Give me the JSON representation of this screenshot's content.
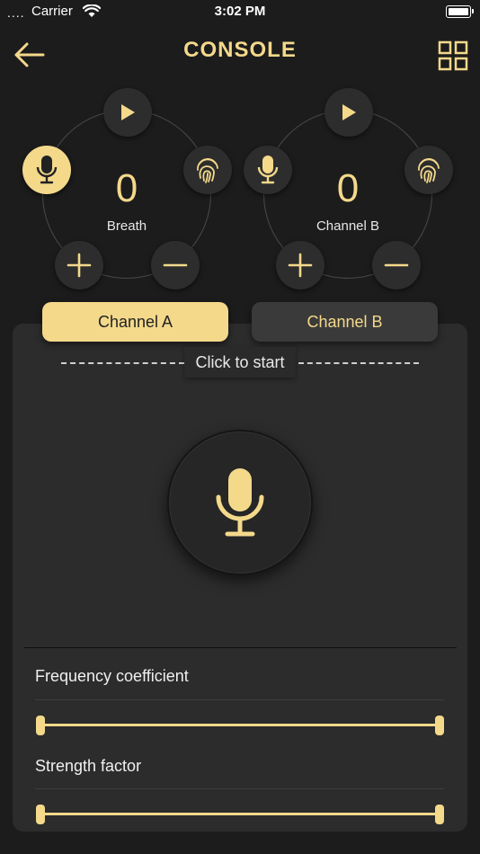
{
  "status_bar": {
    "signal": "....",
    "carrier": "Carrier",
    "time": "3:02 PM"
  },
  "nav": {
    "title": "CONSOLE",
    "back_icon": "arrow-left-icon",
    "menu_icon": "grid-icon"
  },
  "dials": [
    {
      "value": "0",
      "label": "Breath",
      "active_button": "mic"
    },
    {
      "value": "0",
      "label": "Channel B",
      "active_button": "none"
    }
  ],
  "tabs": [
    {
      "label": "Channel A",
      "selected": true
    },
    {
      "label": "Channel B",
      "selected": false
    }
  ],
  "panel": {
    "start_text": "Click to start",
    "params": [
      {
        "label": "Frequency coefficient",
        "range": [
          0,
          1
        ]
      },
      {
        "label": "Strength factor",
        "range": [
          0,
          1
        ]
      }
    ]
  },
  "colors": {
    "accent": "#f4d98b",
    "background": "#1c1c1c",
    "panel": "#2c2c2c",
    "button": "#2d2d2d"
  }
}
